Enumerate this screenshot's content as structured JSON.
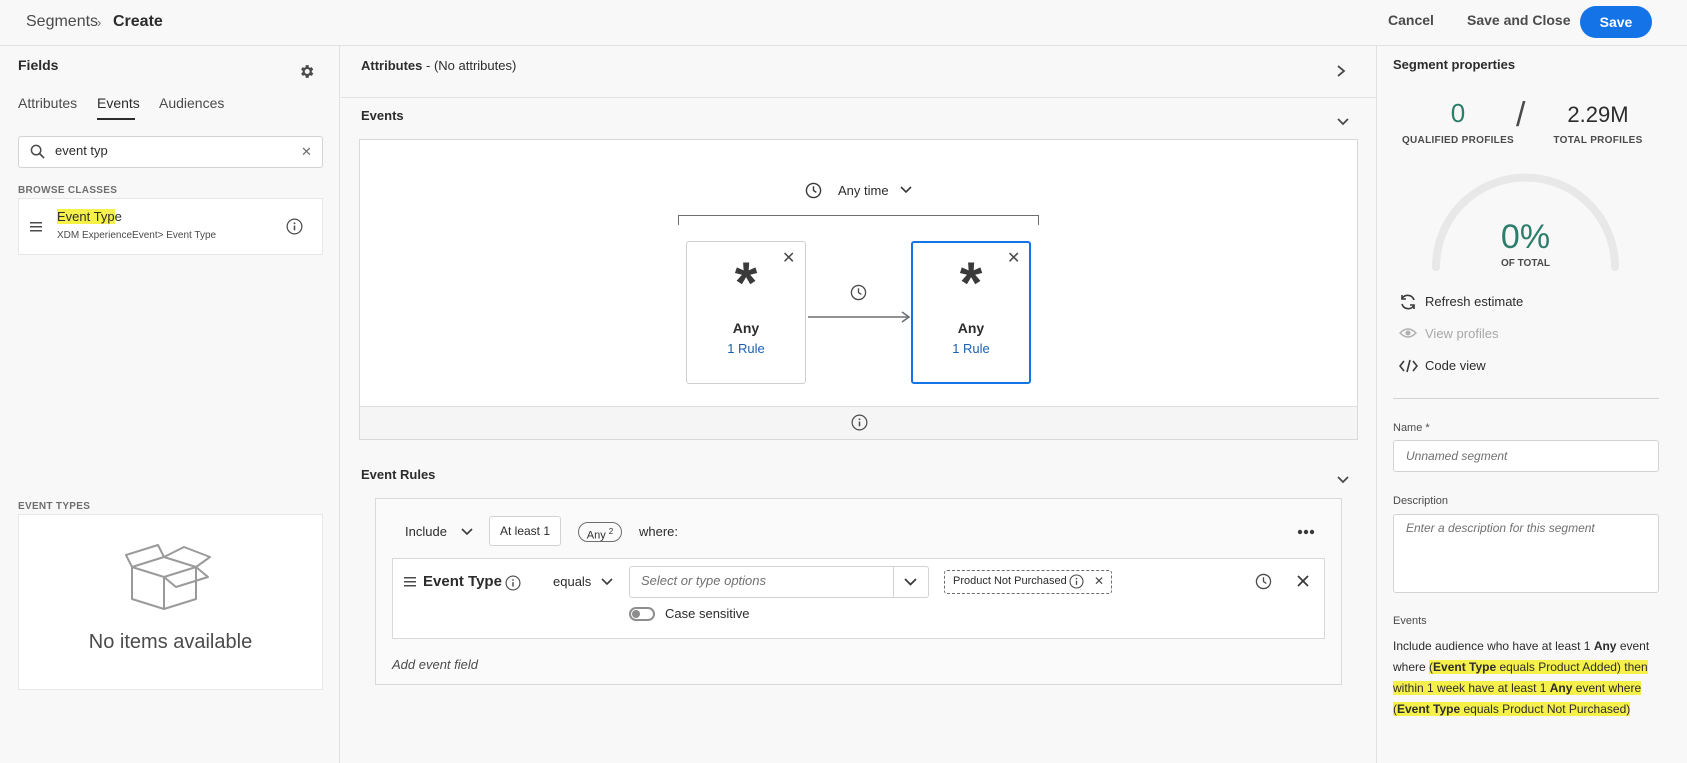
{
  "breadcrumb": {
    "parent": "Segments",
    "separator": "›",
    "current": "Create"
  },
  "header_actions": {
    "cancel": "Cancel",
    "save_close": "Save and Close",
    "save": "Save"
  },
  "fields_panel": {
    "title": "Fields",
    "tabs": [
      "Attributes",
      "Events",
      "Audiences"
    ],
    "active_tab": "Events",
    "search_value": "event typ",
    "browse_label": "BROWSE CLASSES",
    "class_item": {
      "title_highlight": "Event Typ",
      "title_rest": "e",
      "path": "XDM ExperienceEvent> Event Type"
    },
    "event_types_label": "EVENT TYPES",
    "empty_text": "No items available"
  },
  "attributes_section": {
    "title": "Attributes",
    "suffix": " - (No attributes)"
  },
  "events_section": {
    "title": "Events",
    "time_filter": "Any time",
    "nodes": [
      {
        "symbol": "*",
        "label": "Any",
        "rule": "1 Rule",
        "selected": false
      },
      {
        "symbol": "*",
        "label": "Any",
        "rule": "1 Rule",
        "selected": true
      }
    ]
  },
  "event_rules": {
    "title": "Event Rules",
    "include": "Include",
    "at_least": "At least 1",
    "any_pill": "Any",
    "any_pill_sup": "2",
    "where": "where:",
    "condition": {
      "field": "Event Type",
      "operator": "equals",
      "placeholder": "Select or type options",
      "tag": "Product Not Purchased",
      "case_sensitive_label": "Case sensitive"
    },
    "add_field": "Add event field"
  },
  "segment_properties": {
    "title": "Segment properties",
    "qualified_value": "0",
    "qualified_label": "QUALIFIED PROFILES",
    "slash": "/",
    "total_value": "2.29M",
    "total_label": "TOTAL PROFILES",
    "percent": "0%",
    "percent_label": "OF TOTAL",
    "actions": [
      "Refresh estimate",
      "View profiles",
      "Code view"
    ],
    "name_label": "Name *",
    "name_placeholder": "Unnamed segment",
    "description_label": "Description",
    "description_placeholder": "Enter a description for this segment",
    "events_label": "Events",
    "summary": {
      "p1": "Include audience who have at least 1 ",
      "b1": "Any",
      "p2": " event where ",
      "p3": "(",
      "b2": "Event Type",
      "p4": " equals Product Added) then within 1 week have at least 1 ",
      "b3": "Any",
      "p5": " event where (",
      "b4": "Event Type",
      "p6": " equals Product Not Purchased)"
    }
  },
  "colors": {
    "accent": "#1473e6",
    "teal": "#2d7d6b",
    "highlight": "#f6f04a"
  }
}
